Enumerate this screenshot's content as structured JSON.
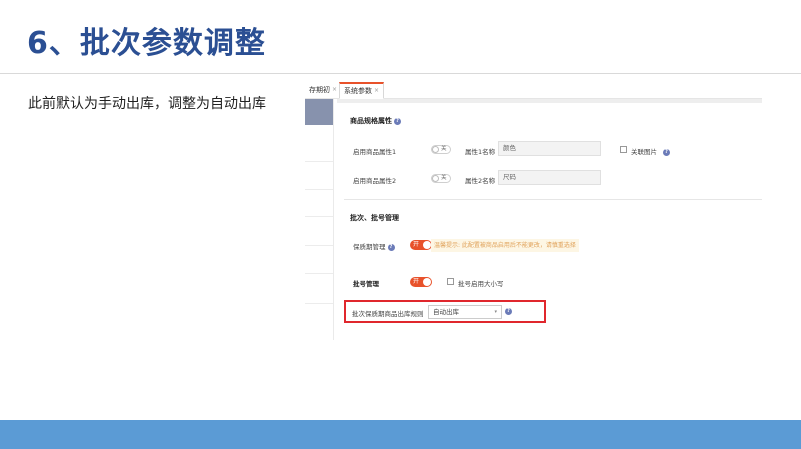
{
  "slide": {
    "title": "6、批次参数调整",
    "description": "此前默认为手动出库，调整为自动出库"
  },
  "screenshot": {
    "tabs": [
      {
        "label": "存期初",
        "close": "×"
      },
      {
        "label": "系统参数",
        "close": "×"
      }
    ],
    "spec_section": {
      "title": "商品规格属性",
      "attr1": {
        "label": "启用商品属性1",
        "toggle_text": "关",
        "name_label": "属性1名称",
        "value": "颜色"
      },
      "attr2": {
        "label": "启用商品属性2",
        "toggle_text": "关",
        "name_label": "属性2名称",
        "value": "尺码"
      },
      "link_image_label": "关联图片"
    },
    "batch_section": {
      "title": "批次、批号管理",
      "shelf_life": {
        "label": "保质期管理",
        "toggle_text": "开",
        "hint": "温馨提示: 此配置被商品启用后不能更改，请慎重选择"
      },
      "batch_no": {
        "label": "批号管理",
        "toggle_text": "开",
        "checkbox_label": "批号启用大小写"
      },
      "outbound_rule": {
        "label": "批次保质期商品出库规则",
        "selected": "自动出库",
        "caret": "▾"
      }
    },
    "help_glyph": "?",
    "colors": {
      "accent": "#e8522b",
      "title_blue": "#2b4f93",
      "highlight_red": "#e0272d",
      "bottom_bar": "#5b9bd5"
    }
  }
}
